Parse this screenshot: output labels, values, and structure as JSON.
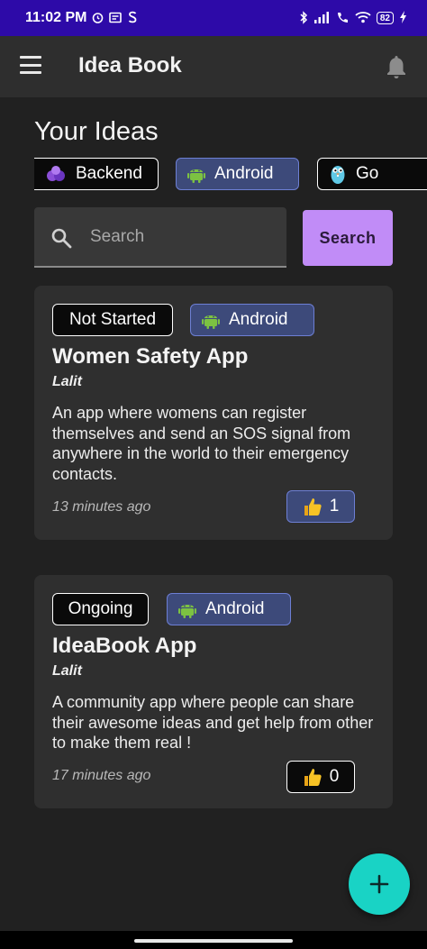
{
  "status_bar": {
    "time": "11:02 PM",
    "battery": "82",
    "icons": [
      "alarm-icon",
      "message-icon",
      "s-icon",
      "bluetooth-icon",
      "signal-icon",
      "wifi-call-icon",
      "wifi-icon",
      "battery-icon",
      "charging-icon"
    ]
  },
  "app_bar": {
    "title": "Idea Book",
    "menu_icon": "hamburger-menu-icon",
    "notification_icon": "bell-icon"
  },
  "section_title": "Your Ideas",
  "filter_chips": [
    {
      "label": "Backend",
      "icon": "backend-icon",
      "selected": false
    },
    {
      "label": "Android",
      "icon": "android-icon",
      "selected": true
    },
    {
      "label": "Go",
      "icon": "gopher-icon",
      "selected": false
    }
  ],
  "search": {
    "placeholder": "Search",
    "value": "",
    "button_label": "Search"
  },
  "ideas": [
    {
      "status": "Not Started",
      "tag": "Android",
      "title": "Women Safety App",
      "author": "Lalit",
      "description": "An app where womens can register themselves and send an SOS signal from anywhere in the world to their emergency contacts.",
      "time": "13 minutes ago",
      "likes": "1",
      "liked": true
    },
    {
      "status": "Ongoing",
      "tag": "Android",
      "title": "IdeaBook App",
      "author": "Lalit",
      "description": "A community app where people can share their awesome ideas and get help from other to make them real !",
      "time": "17 minutes ago",
      "likes": "0",
      "liked": false
    }
  ],
  "fab": {
    "icon": "plus-icon"
  },
  "colors": {
    "status_bar": "#2d0aa8",
    "background": "#212121",
    "card": "#2f2f2f",
    "accent_button": "#c18cf7",
    "fab": "#19d3c5",
    "chip_selected": "#3d4a7a",
    "android_green": "#7cc242"
  }
}
